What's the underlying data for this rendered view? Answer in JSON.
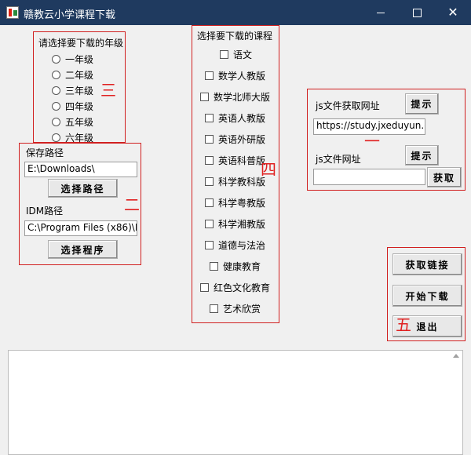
{
  "window": {
    "title": "赣教云小学课程下载"
  },
  "grade": {
    "label": "请选择要下载的年级",
    "options": [
      "一年级",
      "二年级",
      "三年级",
      "四年级",
      "五年级",
      "六年级"
    ],
    "marker": "三"
  },
  "save": {
    "label": "保存路径",
    "value": "E:\\Downloads\\",
    "choose_btn": "选择路径",
    "idm_label": "IDM路径",
    "idm_value": "C:\\Program Files (x86)\\In",
    "choose_program_btn": "选择程序",
    "marker": "二"
  },
  "courses": {
    "label": "选择要下载的课程",
    "items": [
      "语文",
      "数学人教版",
      "数学北师大版",
      "英语人教版",
      "英语外研版",
      "英语科普版",
      "科学教科版",
      "科学粤教版",
      "科学湘教版",
      "道德与法治",
      "健康教育",
      "红色文化教育",
      "艺术欣赏"
    ],
    "marker": "四"
  },
  "js": {
    "fetch_label": "js文件获取网址",
    "hint_btn": "提示",
    "fetch_value": "https://study.jxeduyun.c",
    "url_label": "js文件网址",
    "hint_btn2": "提示",
    "url_value": "",
    "get_btn": "获取",
    "marker": "一"
  },
  "actions": {
    "get_link_btn": "获取链接",
    "start_btn": "开始下载",
    "exit_btn": "退出",
    "marker": "五"
  }
}
